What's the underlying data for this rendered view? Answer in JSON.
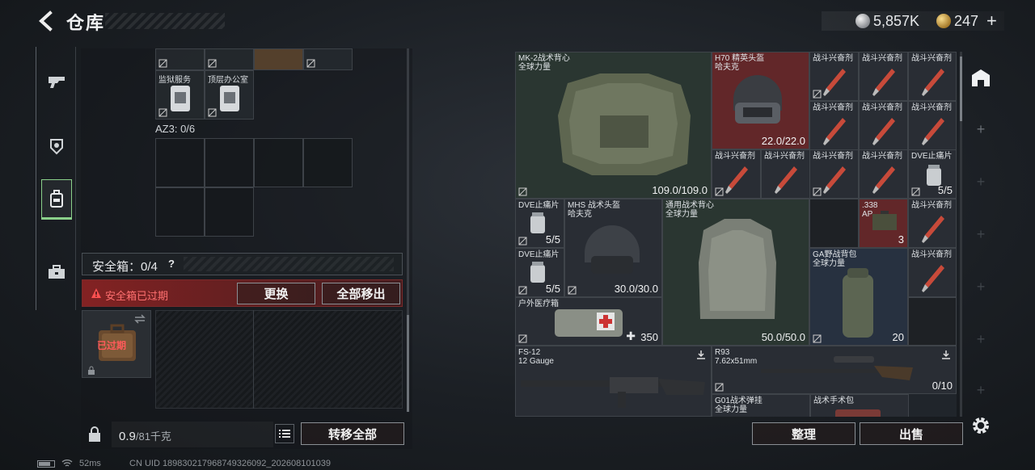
{
  "header": {
    "title": "仓库",
    "currency": {
      "silver": "5,857K",
      "gold": "247",
      "add_label": "+"
    }
  },
  "left_rail": {
    "items": [
      {
        "name": "weapons",
        "icon": "gun-icon"
      },
      {
        "name": "armor",
        "icon": "helmet-armor-icon"
      },
      {
        "name": "backpack",
        "icon": "backpack-icon",
        "active": true
      },
      {
        "name": "case",
        "icon": "briefcase-icon"
      }
    ]
  },
  "storage": {
    "top_cells": [
      {
        "label": "监狱服务"
      },
      {
        "label": "顶层办公室"
      }
    ],
    "az3_label": "AZ3: 0/6"
  },
  "safebox": {
    "label": "安全箱：0/4",
    "help": "?",
    "expired_text": "安全箱已过期",
    "replace_label": "更换",
    "moveall_label": "全部移出",
    "slot_status": "已过期"
  },
  "footer_left": {
    "weight_value": "0.9",
    "weight_total": "/81千克",
    "transfer_all_label": "转移全部"
  },
  "status_bar": {
    "ping": "52ms",
    "uid": "CN UID 189830217968749326092_202608101039"
  },
  "inventory": {
    "vest1": {
      "name": "MK-2战术背心",
      "sub": "全球力量",
      "durability": "109.0/109.0"
    },
    "helmet1": {
      "name": "H70 精英头盔",
      "sub": "哈夫克",
      "durability": "22.0/22.0"
    },
    "stim_label": "战斗兴奋剂",
    "dve_label": "DVE止痛片",
    "dve_count": "5/5",
    "helmet2": {
      "name": "MHS 战术头盔",
      "sub": "哈夫克",
      "durability": "30.0/30.0"
    },
    "vest2": {
      "name": "通用战术背心",
      "sub": "全球力量",
      "durability": "50.0/50.0"
    },
    "ammo": {
      "name": ".338",
      "sub": "AP",
      "count": "3"
    },
    "bag": {
      "name": "GA野战背包",
      "sub": "全球力量",
      "capacity": "20"
    },
    "medkit": {
      "name": "户外医疗箱",
      "value": "350"
    },
    "gun1": {
      "name": "FS-12",
      "sub": "12 Gauge"
    },
    "gun2": {
      "name": "R93",
      "sub": "7.62x51mm",
      "ammo": "0/10"
    },
    "rig": {
      "name": "G01战术弹挂",
      "sub": "全球力量"
    },
    "surgery": {
      "name": "战术手术包"
    }
  },
  "actions": {
    "tidy_label": "整理",
    "sell_label": "出售"
  },
  "colors": {
    "active_green": "#8ad08a",
    "expired_red": "#ff5a5a",
    "rare_red_bg": "#782828"
  }
}
